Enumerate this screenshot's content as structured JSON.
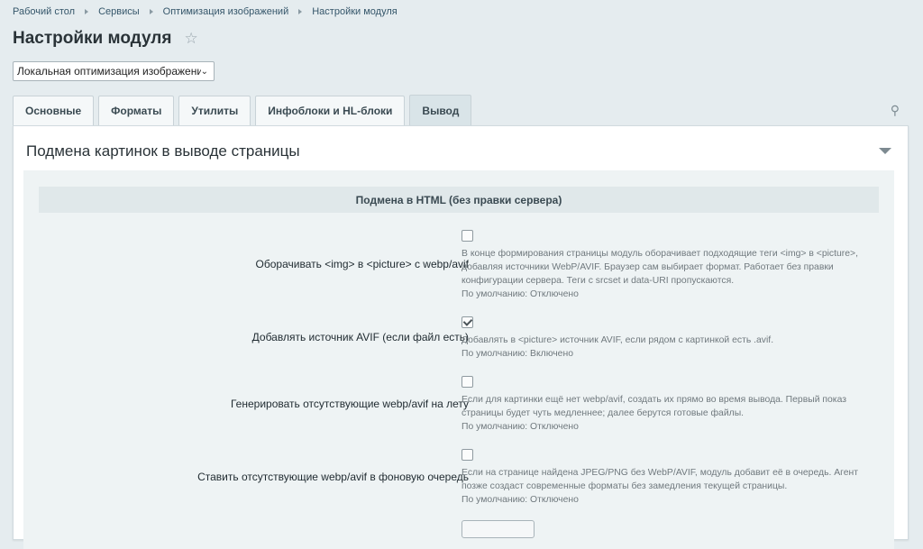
{
  "breadcrumb": [
    "Рабочий стол",
    "Сервисы",
    "Оптимизация изображений",
    "Настройки модуля"
  ],
  "page_title": "Настройки модуля",
  "site_select": {
    "value": "Локальная оптимизация изображений"
  },
  "tabs": [
    {
      "label": "Основные",
      "active": false
    },
    {
      "label": "Форматы",
      "active": false
    },
    {
      "label": "Утилиты",
      "active": false
    },
    {
      "label": "Инфоблоки и HL-блоки",
      "active": false
    },
    {
      "label": "Вывод",
      "active": true
    }
  ],
  "panel": {
    "title": "Подмена картинок в выводе страницы",
    "section_heading": "Подмена в HTML (без правки сервера)",
    "options": [
      {
        "label": "Оборачивать <img> в <picture> с webp/avif",
        "checked": false,
        "desc": "В конце формирования страницы модуль оборачивает подходящие теги <img> в <picture>, добавляя источники WebP/AVIF. Браузер сам выбирает формат. Работает без правки конфигурации сервера. Теги с srcset и data-URI пропускаются.",
        "default": "По умолчанию: Отключено"
      },
      {
        "label": "Добавлять источник AVIF (если файл есть)",
        "checked": true,
        "desc": "Добавлять в <picture> источник AVIF, если рядом с картинкой есть .avif.",
        "default": "По умолчанию: Включено"
      },
      {
        "label": "Генерировать отсутствующие webp/avif на лету",
        "checked": false,
        "desc": "Если для картинки ещё нет webp/avif, создать их прямо во время вывода. Первый показ страницы будет чуть медленнее; далее берутся готовые файлы.",
        "default": "По умолчанию: Отключено"
      },
      {
        "label": "Ставить отсутствующие webp/avif в фоновую очередь",
        "checked": false,
        "desc": "Если на странице найдена JPEG/PNG без WebP/AVIF, модуль добавит её в очередь. Агент позже создаст современные форматы без замедления текущей страницы.",
        "default": "По умолчанию: Отключено"
      }
    ]
  }
}
